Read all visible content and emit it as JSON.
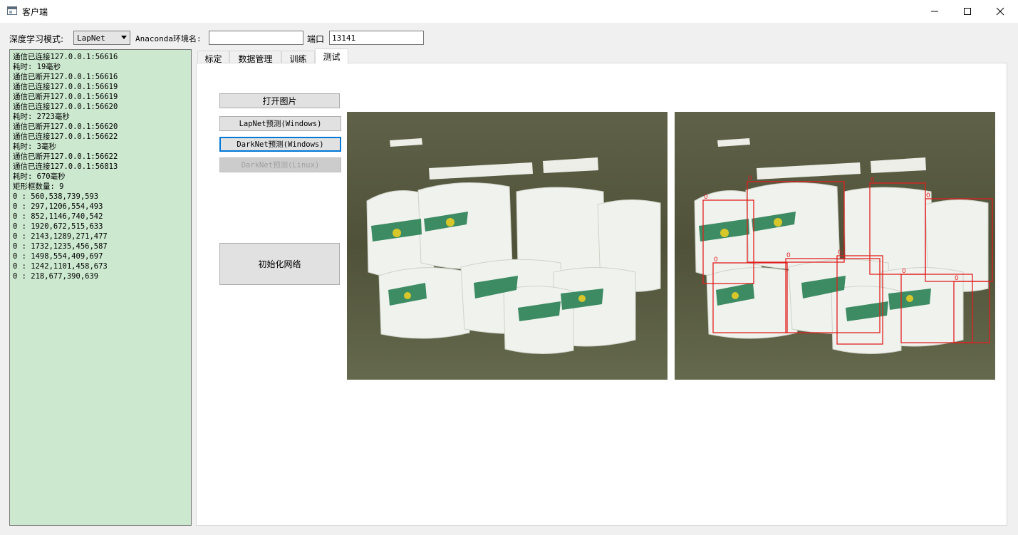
{
  "window": {
    "title": "客户端"
  },
  "toolbar": {
    "mode_label": "深度学习模式:",
    "mode_value": "LapNet",
    "env_label": "Anaconda环境名:",
    "env_value": "",
    "port_label": "端口",
    "port_value": "13141"
  },
  "log": [
    "通信已连接127.0.0.1:56616",
    "耗时: 19毫秒",
    "通信已断开127.0.0.1:56616",
    "通信已连接127.0.0.1:56619",
    "通信已断开127.0.0.1:56619",
    "通信已连接127.0.0.1:56620",
    "耗时: 2723毫秒",
    "通信已断开127.0.0.1:56620",
    "通信已连接127.0.0.1:56622",
    "耗时: 3毫秒",
    "通信已断开127.0.0.1:56622",
    "通信已连接127.0.0.1:56813",
    "耗时: 670毫秒",
    "矩形框数量: 9",
    "0 : 560,538,739,593",
    "0 : 297,1206,554,493",
    "0 : 852,1146,740,542",
    "0 : 1920,672,515,633",
    "0 : 2143,1289,271,477",
    "0 : 1732,1235,456,587",
    "0 : 1498,554,409,697",
    "0 : 1242,1101,458,673",
    "0 : 218,677,390,639"
  ],
  "tabs": [
    "标定",
    "数据管理",
    "训练",
    "测试"
  ],
  "active_tab": "测试",
  "buttons": {
    "open_image": "打开图片",
    "lapnet_predict": "LapNet预测(Windows)",
    "darknet_predict_win": "DarkNet预测(Windows)",
    "darknet_predict_linux": "DarkNet预测(Linux)",
    "init_network": "初始化网络"
  },
  "images": {
    "original": "warehouse bags photo",
    "detected": "warehouse bags photo with detection boxes",
    "box_class_label": "0",
    "box_color": "#e02020"
  }
}
